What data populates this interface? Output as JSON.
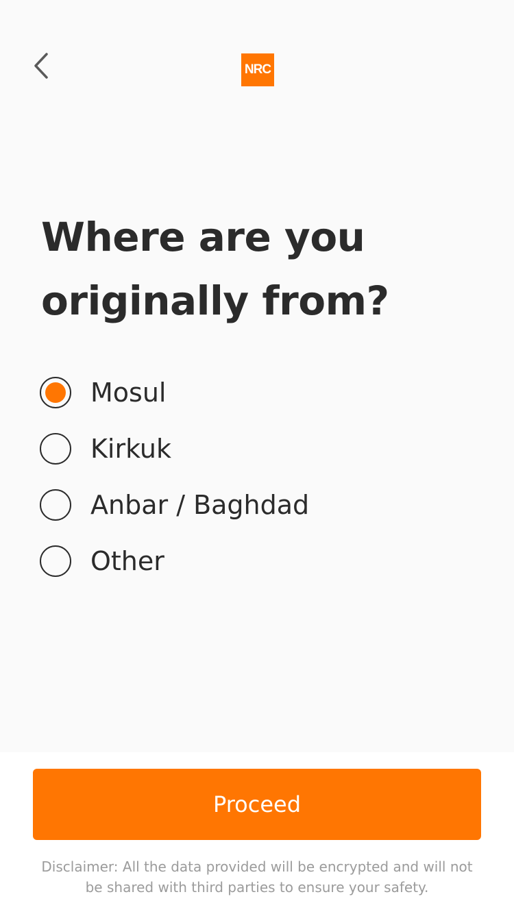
{
  "header": {
    "back_icon": "chevron-left-icon",
    "logo_text": "NRC",
    "logo_color": "#ff7602"
  },
  "question": {
    "title": "Where are you originally from?"
  },
  "options": [
    {
      "label": "Mosul",
      "selected": true
    },
    {
      "label": "Kirkuk",
      "selected": false
    },
    {
      "label": "Anbar / Baghdad",
      "selected": false
    },
    {
      "label": "Other",
      "selected": false
    }
  ],
  "footer": {
    "proceed_label": "Proceed",
    "disclaimer": "Disclaimer: All the data provided will be encrypted and will not be shared with third parties to ensure your safety."
  },
  "colors": {
    "accent": "#ff7602",
    "text": "#2b2b2b",
    "muted": "#9b9b9b",
    "background": "#fafafa"
  }
}
